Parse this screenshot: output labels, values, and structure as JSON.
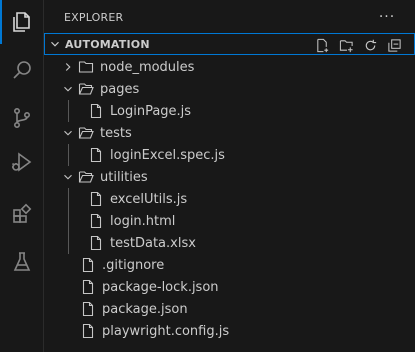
{
  "sidebar": {
    "title": "EXPLORER",
    "more_label": "···",
    "section_title": "AUTOMATION"
  },
  "activity_bar": {
    "items": [
      {
        "icon": "files-icon",
        "active": true
      },
      {
        "icon": "search-icon",
        "active": false
      },
      {
        "icon": "source-control-icon",
        "active": false
      },
      {
        "icon": "run-debug-icon",
        "active": false
      },
      {
        "icon": "extensions-icon",
        "active": false
      },
      {
        "icon": "testing-icon",
        "active": false
      }
    ]
  },
  "section_actions": [
    "new-file-icon",
    "new-folder-icon",
    "refresh-icon",
    "collapse-all-icon"
  ],
  "tree": [
    {
      "label": "node_modules",
      "type": "folder",
      "expanded": false,
      "depth": 0
    },
    {
      "label": "pages",
      "type": "folder",
      "expanded": true,
      "depth": 0
    },
    {
      "label": "LoginPage.js",
      "type": "file",
      "depth": 1
    },
    {
      "label": "tests",
      "type": "folder",
      "expanded": true,
      "depth": 0
    },
    {
      "label": "loginExcel.spec.js",
      "type": "file",
      "depth": 1
    },
    {
      "label": "utilities",
      "type": "folder",
      "expanded": true,
      "depth": 0
    },
    {
      "label": "excelUtils.js",
      "type": "file",
      "depth": 1
    },
    {
      "label": "login.html",
      "type": "file",
      "depth": 1
    },
    {
      "label": "testData.xlsx",
      "type": "file",
      "depth": 1
    },
    {
      "label": ".gitignore",
      "type": "file",
      "depth": 0
    },
    {
      "label": "package-lock.json",
      "type": "file",
      "depth": 0
    },
    {
      "label": "package.json",
      "type": "file",
      "depth": 0
    },
    {
      "label": "playwright.config.js",
      "type": "file",
      "depth": 0
    }
  ],
  "colors": {
    "background": "#181818",
    "foreground": "#cccccc",
    "accent": "#0078d4",
    "icon": "#c5c5c5",
    "guide": "#585858"
  }
}
